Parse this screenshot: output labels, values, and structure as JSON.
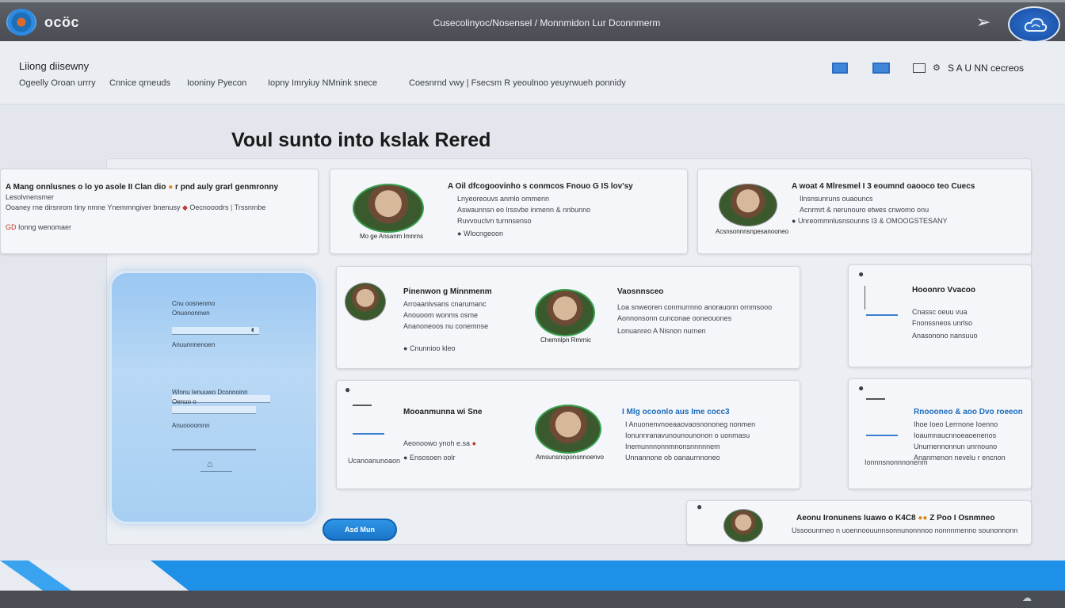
{
  "header": {
    "brand": "ocöc",
    "title": "Cusecolinyoc/Nosensel / Monnmidon Lur Dconnmerm",
    "share_icon": "share-arrow-icon",
    "user_icon": "cloud-icon"
  },
  "nav": {
    "title": "Liiong diisewny",
    "links": [
      "Ogeelly Oroan urrry",
      "Cnnice qrneuds",
      "Iooniny Pyecon",
      "Iopny Imryiuy NMnink snece",
      "Coesnrnd vwy | Fsecsm R yeoulnoo yeuyrwueh ponnidy"
    ],
    "toolbar_text": "S A U NN cecreos"
  },
  "main": {
    "heading": "Voul sunto into kslak Rered",
    "button": "Asd Mun"
  },
  "card1": {
    "line1": "A Mang onnlusnes o lo yo asole II Clan dio",
    "line1b": "r pnd auly grarl genmronny",
    "line2": "Lesolvnensmer",
    "line3": "Ooaney rne dirsnrom tiny nmne",
    "line3b": "Ynemmngiver bnenusy",
    "line3c": "Oecnooodrs",
    "line3d": "Trssnmbe",
    "line4": "Ionng wenomaer"
  },
  "card2": {
    "line1": "A Oil dfcogoovinho s conmcos",
    "line1b": "Fnouo G",
    "line1c": "IS lov'sy",
    "line2": "Lnyeoreouvs anmlo ommenn",
    "line3": "Aswaunnsn eo lrssvbe inmenn & nnbunno",
    "line4": "Ruvvouclvn turnnsenso",
    "line5": "Wlocngeoon",
    "caption": "Mo ge Ansanm Imnrns"
  },
  "card3": {
    "line1": "A woat 4 Mlresmel I 3 eoumnd",
    "line1b": "oaooco teo Cuecs",
    "line2": "Ilnsnsunruns ouaouncs",
    "line3": "Acnrmrt & nerunouro etwes cnwomo onu",
    "line4": "Unreommnlusnsounns",
    "line4b": "I3 & OMOOGSTESANY",
    "caption": "Acsnsonnnsnpesanooneo"
  },
  "card4": {
    "line1": "Pinenwon g Minnmenm",
    "line2": "Arroaanlvsans cnarumanc",
    "line3": "Anouoom wonms osme",
    "line4": "Ananoneoos nu conemnse",
    "line5": "Cnunnioo kleo",
    "title": "Vaosnnsceo",
    "line6": "Loa snweoren conmurrnno anorauonn ornmsooo",
    "line7": "Aonnonsonn cunconae ooneouones",
    "line8": "Lonuanreo A Nisnon nurnen",
    "caption": "Chemnlpn Rmrnic"
  },
  "card5": {
    "title": "Hooonro Vvacoo",
    "line1": "Cnassc oeuu vua",
    "line2": "Fnonssneos unrlso",
    "line3": "Anasonono nansuuo"
  },
  "card6": {
    "line1": "Mooanmunna",
    "line1b": "wi Sne",
    "line2": "Aeonoowo ynoh e.sa",
    "line3": "Ucanoanunoaon",
    "line4": "Ensosoen oolr",
    "title": "I Mlg ocoonlo aus Ime cocc3",
    "line5": "I Anuonenvnoeaaovaosnononeg nonmen",
    "line6": "Ionunnranavunounounonon o uonmasu",
    "line7": "Inemunnnonnmnonsnnnnnem",
    "line8": "Unnannone ob oanaurnnoneo",
    "caption": "Amsunsnoponsnnoenvo"
  },
  "card7": {
    "title": "Rnoooneo & aoo Dvo roeeon",
    "line1": "Ihoe Ioeo Lerrnone Ioenno",
    "line2": "Ioaumnaucnnoeaoenenos",
    "line3": "Unurnennonnun unrnouno",
    "line4": "Ananrnenon nevelu r encnon",
    "caption": "Ionnnsnonnnonenm"
  },
  "card8": {
    "line1": "Aeonu Ironunens Iuawo o K4C8",
    "line1b": "Z Poo I Osnmneo",
    "line2": "Ussoounrneo n uoennoouunnsonnunonnnoo nonnnmenno sounonnonn"
  },
  "form": {
    "label1": "Cnu oosnenmo",
    "label2": "Onuononnwn",
    "label3": "Anuunnnenoen",
    "label4": "Wlnnu Ienuuwo Dconnoinn",
    "label5": "Oenuo o",
    "label6": "Anuoooomnn"
  },
  "colors": {
    "topbar": "#4f5359",
    "accent": "#1e90e8",
    "card_bg": "#f4f6f9",
    "green": "#2a9a3c"
  }
}
